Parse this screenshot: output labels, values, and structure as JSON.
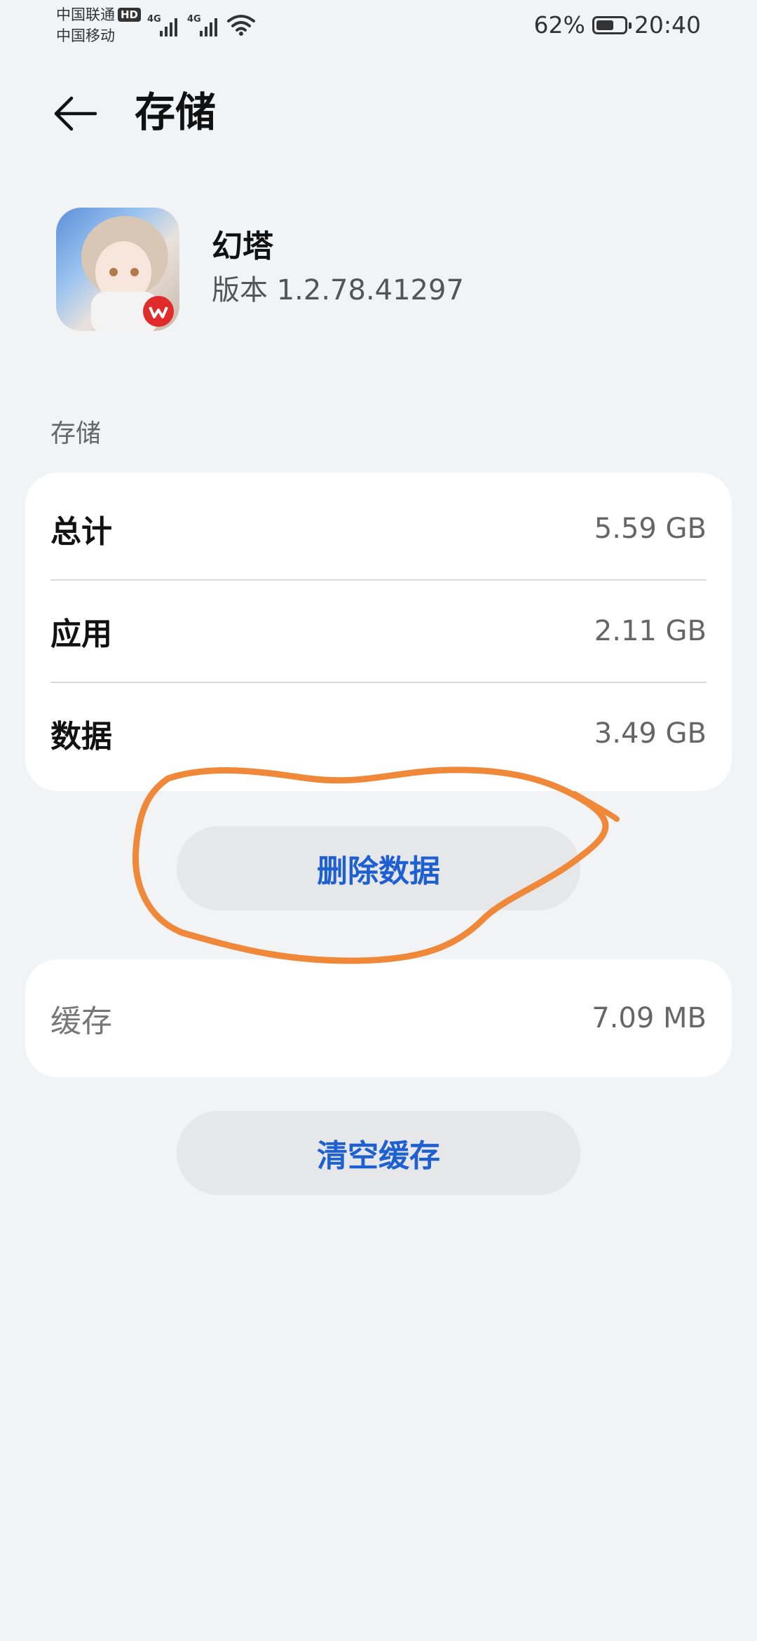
{
  "status_bar": {
    "carrier_1": "中国联通",
    "hd_badge": "HD",
    "carrier_2": "中国移动",
    "network_1": "4G",
    "network_2": "4G",
    "battery_percent": "62%",
    "battery_level": 0.62,
    "time": "20:40"
  },
  "header": {
    "title": "存储"
  },
  "app": {
    "name": "幻塔",
    "version": "版本 1.2.78.41297"
  },
  "storage_section": {
    "label": "存储",
    "rows": [
      {
        "label": "总计",
        "value": "5.59 GB"
      },
      {
        "label": "应用",
        "value": "2.11 GB"
      },
      {
        "label": "数据",
        "value": "3.49 GB"
      }
    ],
    "delete_button": "删除数据"
  },
  "cache_section": {
    "label": "缓存",
    "value": "7.09 MB",
    "clear_button": "清空缓存"
  },
  "colors": {
    "accent": "#1e5fd1",
    "annotation": "#f0883a",
    "background": "#f1f3f5"
  }
}
